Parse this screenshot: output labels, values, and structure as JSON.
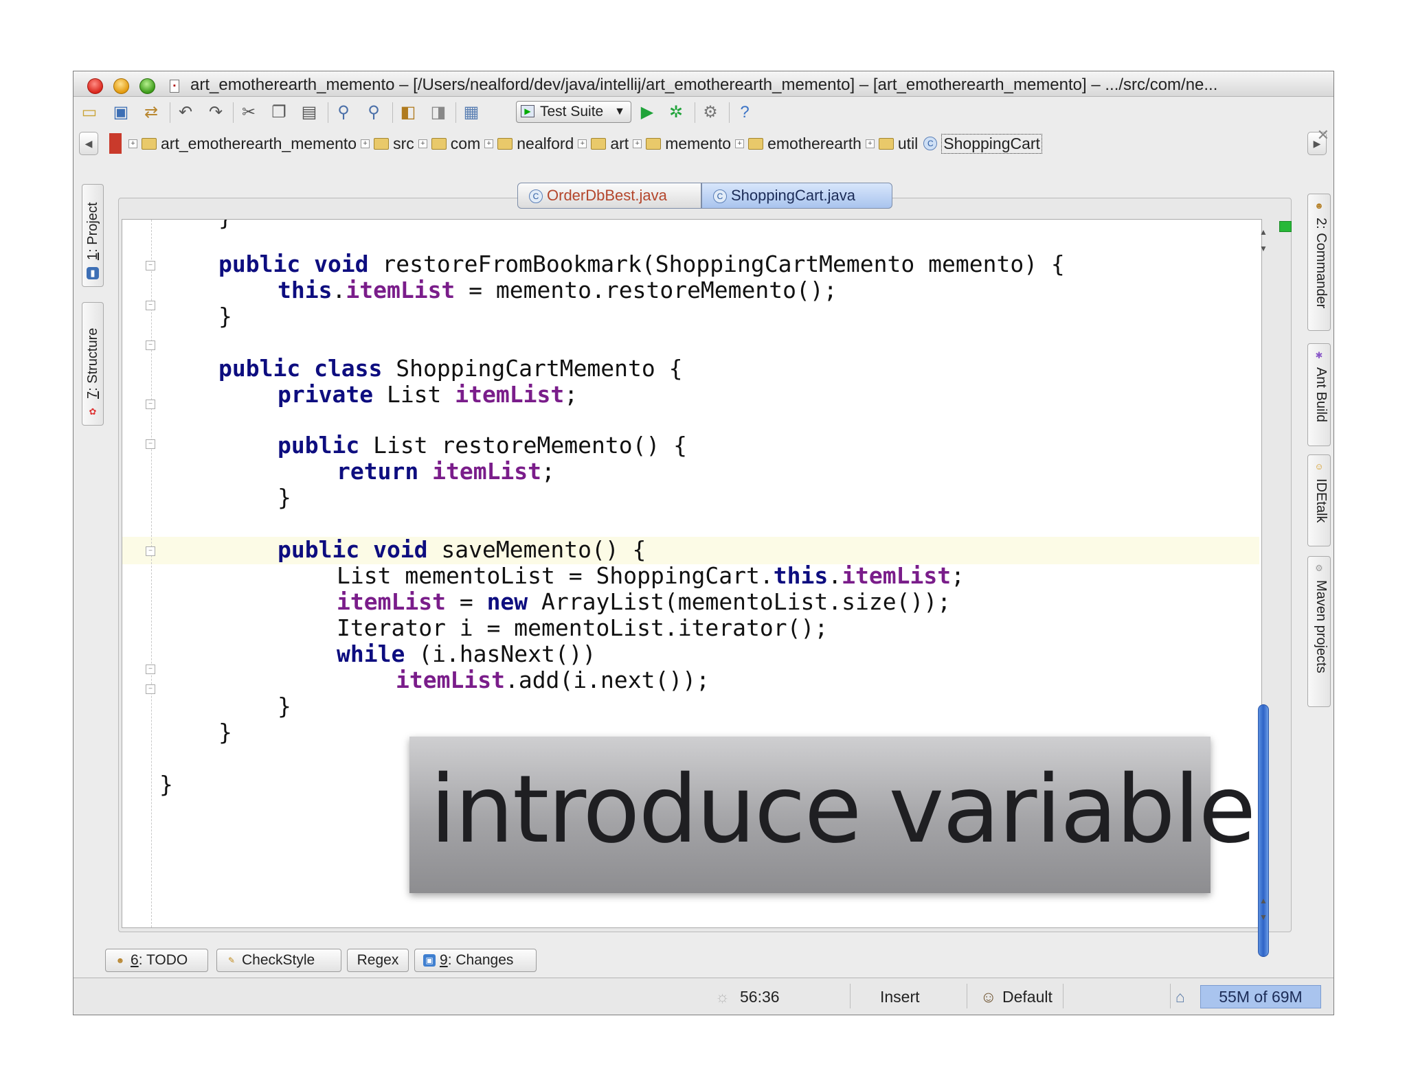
{
  "window": {
    "title": "art_emotherearth_memento – [/Users/nealford/dev/java/intellij/art_emotherearth_memento] – [art_emotherearth_memento] – .../src/com/ne..."
  },
  "toolbar": {
    "run_config": "Test Suite",
    "icons": [
      "open-icon",
      "save-icon",
      "sync-icon",
      "undo-icon",
      "redo-icon",
      "cut-icon",
      "copy-icon",
      "paste-icon",
      "find-icon",
      "replace-icon",
      "back-icon",
      "forward-icon",
      "project-structure-icon",
      "run-icon",
      "debug-icon",
      "settings-icon",
      "help-icon"
    ]
  },
  "breadcrumb": {
    "items": [
      "art_emotherearth_memento",
      "src",
      "com",
      "nealford",
      "art",
      "memento",
      "emotherearth",
      "util"
    ],
    "current": "ShoppingCart"
  },
  "editor": {
    "tabs": [
      {
        "label": "OrderDbBest.java",
        "active": false
      },
      {
        "label": "ShoppingCart.java",
        "active": true
      }
    ],
    "cursor_line_highlight": "saveMemento"
  },
  "left_tools": [
    {
      "number": "1",
      "label": ": Project"
    },
    {
      "number": "7",
      "label": ": Structure"
    }
  ],
  "right_tools": [
    {
      "label": "2: Commander"
    },
    {
      "label": "Ant Build"
    },
    {
      "label": "IDEtalk"
    },
    {
      "label": "Maven projects"
    }
  ],
  "overlay": {
    "text": "introduce variable"
  },
  "bottom_tools": [
    {
      "number": "6",
      "label": ": TODO"
    },
    {
      "number": "",
      "label": "CheckStyle"
    },
    {
      "number": "",
      "label": "Regex"
    },
    {
      "number": "9",
      "label": ": Changes"
    }
  ],
  "status": {
    "position": "56:36",
    "mode": "Insert",
    "profile": "Default",
    "memory": "55M of 69M"
  },
  "colors": {
    "keyword": "#0d0d7f",
    "field": "#7a1d8a",
    "active_tab": "#a9c4ee",
    "line_highlight": "#fcfbe6"
  }
}
